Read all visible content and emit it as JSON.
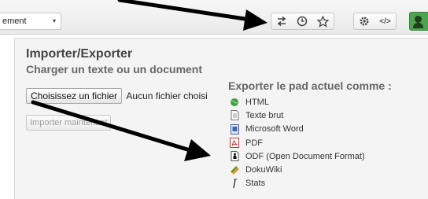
{
  "toolbar": {
    "select_value": "ement",
    "select_caret": "▾",
    "icons": [
      "import-export-icon",
      "history-icon",
      "star-icon",
      "settings-icon",
      "embed-icon",
      "users-icon"
    ],
    "embed_label": "</>",
    "accent": "#4ea44e"
  },
  "import": {
    "title": "Importer/Exporter",
    "subtitle": "Charger un texte ou un document",
    "choose_file_label": "Choisissez un fichier",
    "file_status": "Aucun fichier choisi",
    "import_now_label": "Importer maintenant"
  },
  "export": {
    "title": "Exporter le pad actuel comme :",
    "items": [
      {
        "label": "HTML",
        "icon": "html-icon"
      },
      {
        "label": "Texte brut",
        "icon": "text-file-icon"
      },
      {
        "label": "Microsoft Word",
        "icon": "word-icon"
      },
      {
        "label": "PDF",
        "icon": "pdf-icon"
      },
      {
        "label": "ODF (Open Document Format)",
        "icon": "odf-icon"
      },
      {
        "label": "DokuWiki",
        "icon": "dokuwiki-icon"
      },
      {
        "label": "Stats",
        "icon": "stats-icon"
      }
    ]
  }
}
